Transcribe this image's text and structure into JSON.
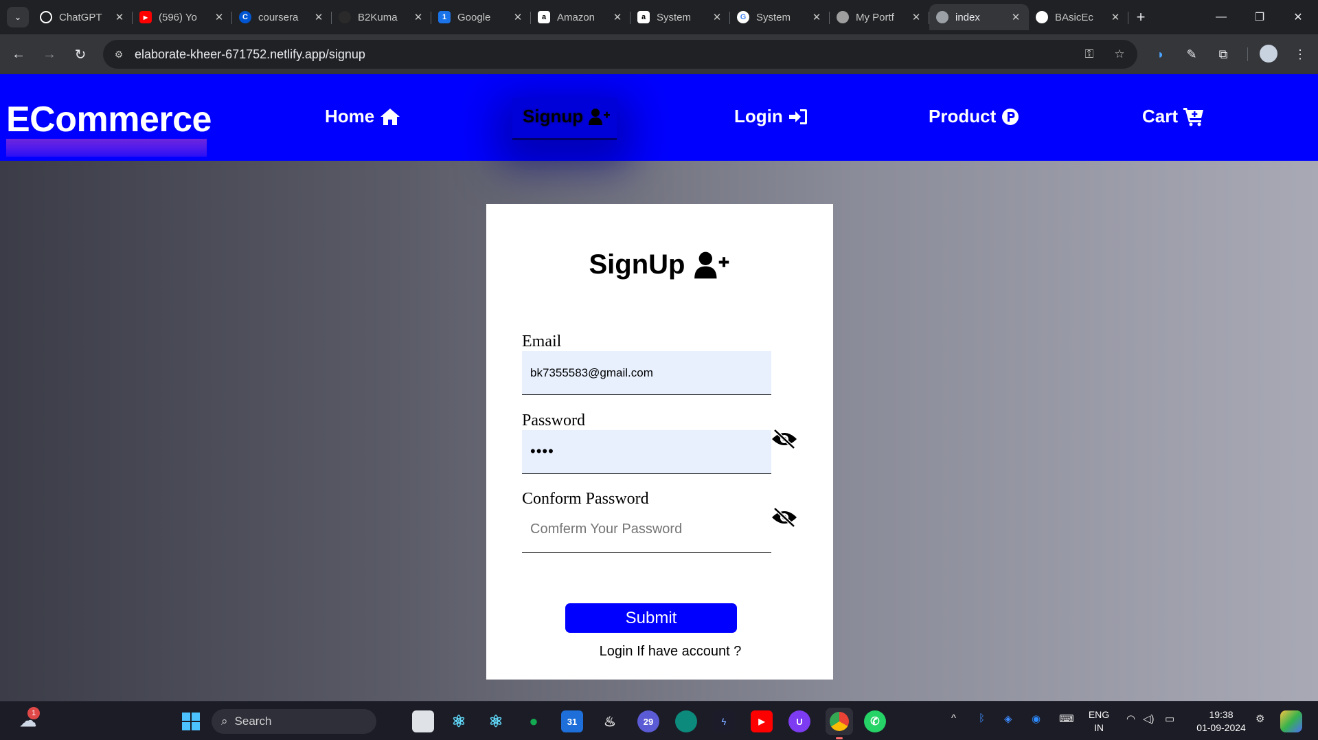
{
  "browser": {
    "tabs": [
      {
        "title": "ChatGPT",
        "favicon": "chatgpt-icon",
        "color": "#ffffff"
      },
      {
        "title": "(596) Yo",
        "favicon": "youtube-icon",
        "color": "#ff0000"
      },
      {
        "title": "coursera",
        "favicon": "coursera-icon",
        "color": "#0056d2"
      },
      {
        "title": "B2Kuma",
        "favicon": "github-icon",
        "color": "#3c3c3c"
      },
      {
        "title": "Google",
        "favicon": "google-calendar-icon",
        "color": "#1a73e8"
      },
      {
        "title": "Amazon",
        "favicon": "amazon-icon",
        "color": "#ffffff"
      },
      {
        "title": "System",
        "favicon": "amazon-icon",
        "color": "#ffffff"
      },
      {
        "title": "System",
        "favicon": "google-icon",
        "color": "#ffffff"
      },
      {
        "title": "My Portf",
        "favicon": "portfolio-avatar-icon",
        "color": "#9e9e9e"
      },
      {
        "title": "index",
        "favicon": "globe-icon",
        "color": "#9aa0a6",
        "active": true
      },
      {
        "title": "BAsicEc",
        "favicon": "github-icon",
        "color": "#ffffff"
      }
    ],
    "url": "elaborate-kheer-671752.netlify.app/signup"
  },
  "navbar": {
    "brand": "ECommerce",
    "items": [
      {
        "label": "Home",
        "icon": "house-icon"
      },
      {
        "label": "Signup",
        "icon": "user-plus-icon",
        "active": true
      },
      {
        "label": "Login",
        "icon": "sign-in-icon"
      },
      {
        "label": "Product",
        "icon": "product-p-icon"
      },
      {
        "label": "Cart",
        "icon": "cart-plus-icon"
      }
    ],
    "accent": "#0000ff"
  },
  "form": {
    "title": "SignUp",
    "email_label": "Email",
    "email_value": "bk7355583@gmail.com",
    "password_label": "Password",
    "password_value": "••••",
    "confirm_label": "Conform Password",
    "confirm_placeholder": "Comferm Your Password",
    "submit_label": "Submit",
    "login_link": "Login If have account ?"
  },
  "taskbar": {
    "search_label": "Search",
    "notification_count": "1",
    "calendar_day": "31",
    "app_badge": "29",
    "lang_top": "ENG",
    "lang_bottom": "IN",
    "time": "19:38",
    "date": "01-09-2024"
  }
}
